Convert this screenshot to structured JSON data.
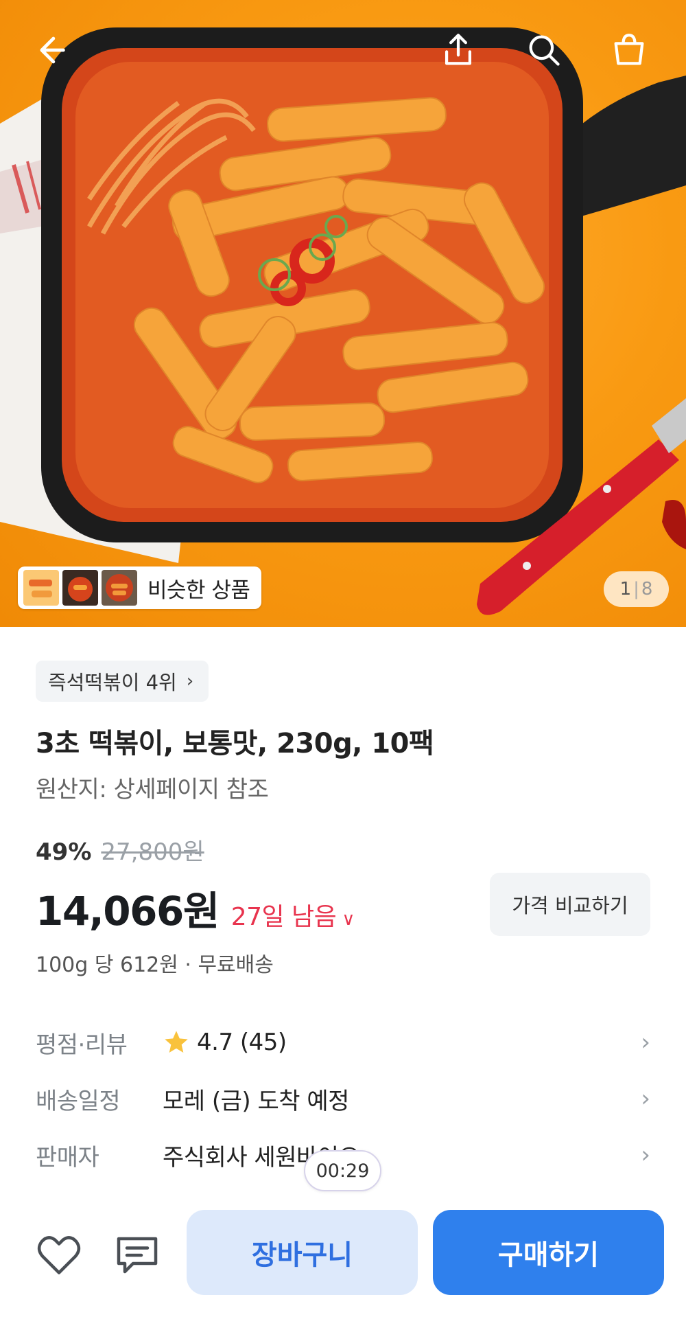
{
  "header": {
    "back_icon": "arrow-left-icon",
    "share_icon": "share-icon",
    "search_icon": "search-icon",
    "cart_icon": "shopping-bag-icon"
  },
  "hero": {
    "similar_label": "비슷한 상품",
    "page_current": "1",
    "page_separator": "|",
    "page_total": "8"
  },
  "product": {
    "rank_badge": "즉석떡볶이 4위",
    "title": "3초 떡볶이, 보통맛, 230g, 10팩",
    "origin": "원산지: 상세페이지 참조",
    "discount": "49%",
    "original_price": "27,800원",
    "price": "14,066원",
    "remaining": "27일 남음",
    "compare_label": "가격 비교하기",
    "unit_price": "100g 당 612원 · 무료배송"
  },
  "info": {
    "rating_label": "평점·리뷰",
    "rating_value": "4.7 (45)",
    "delivery_label": "배송일정",
    "delivery_value": "모레 (금) 도착 예정",
    "seller_label": "판매자",
    "seller_value": "주식회사 세원바이오"
  },
  "timer": "00:29",
  "bottom": {
    "wishlist_icon": "heart-icon",
    "chat_icon": "chat-icon",
    "cart_label": "장바구니",
    "buy_label": "구매하기"
  },
  "colors": {
    "accent_blue": "#2f80ed",
    "cart_bg": "#dde9fb",
    "remaining_red": "#e8344e",
    "star_yellow": "#f9c23c",
    "hero_orange": "#f99a12"
  }
}
